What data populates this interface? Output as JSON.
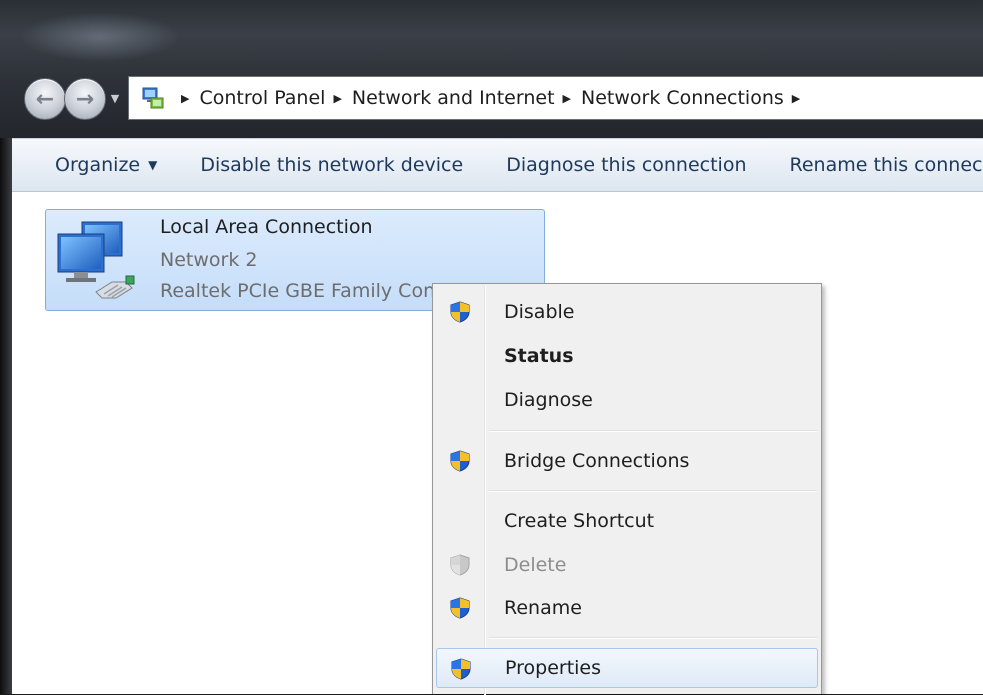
{
  "address_bar": {
    "breadcrumbs": [
      "Control Panel",
      "Network and Internet",
      "Network Connections"
    ]
  },
  "toolbar": {
    "organize": "Organize",
    "disable_device": "Disable this network device",
    "diagnose": "Diagnose this connection",
    "rename": "Rename this connection"
  },
  "connection": {
    "name": "Local Area Connection",
    "network": "Network 2",
    "adapter": "Realtek PCIe GBE Family Controller"
  },
  "context_menu": {
    "items": [
      {
        "label": "Disable",
        "icon": "uac-shield-icon"
      },
      {
        "label": "Status",
        "icon": ""
      },
      {
        "label": "Diagnose",
        "icon": ""
      },
      {
        "label": "Bridge Connections",
        "icon": "uac-shield-icon"
      },
      {
        "label": "Create Shortcut",
        "icon": ""
      },
      {
        "label": "Delete",
        "icon": "uac-shield-disabled-icon"
      },
      {
        "label": "Rename",
        "icon": "uac-shield-icon"
      },
      {
        "label": "Properties",
        "icon": "uac-shield-icon"
      }
    ]
  },
  "colors": {
    "toolbar_text": "#1e395b",
    "selection_fill": "#c5ddfa",
    "selection_border": "#84acdd",
    "menu_background": "#f0f0f0"
  }
}
